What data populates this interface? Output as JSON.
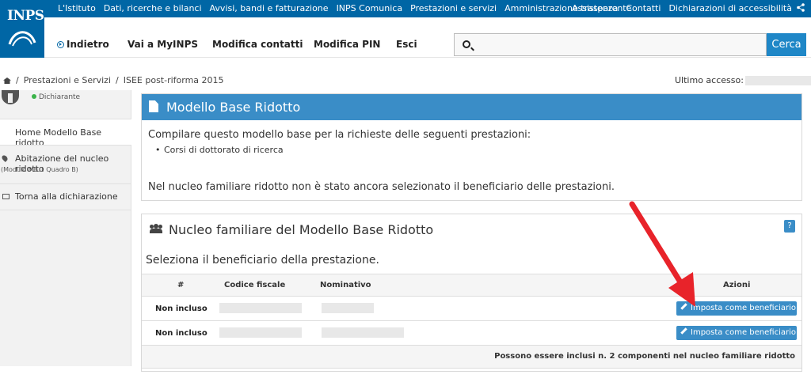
{
  "header": {
    "logo_text": "INPS",
    "top_links": [
      "L'Istituto",
      "Dati, ricerche e bilanci",
      "Avvisi, bandi e fatturazione",
      "INPS Comunica",
      "Prestazioni e servizi",
      "Amministrazione trasparente"
    ],
    "right_links": [
      "Assistenza",
      "Contatti",
      "Dichiarazioni di accessibilità"
    ],
    "share_icon": "share-icon"
  },
  "nav": {
    "back": "Indietro",
    "myinps": "Vai a MyINPS",
    "contacts": "Modifica contatti",
    "pin": "Modifica PIN",
    "exit": "Esci"
  },
  "search": {
    "placeholder": "",
    "value": "",
    "button": "Cerca"
  },
  "breadcrumb": {
    "items": [
      "Prestazioni e Servizi",
      "ISEE post-riforma 2015"
    ],
    "last_access_label": "Ultimo accesso:"
  },
  "sidebar": {
    "role": "Dichiarante",
    "items": [
      {
        "label": "Home Modello Base ridotto",
        "sub": ""
      },
      {
        "label": "Abitazione del nucleo ridotto",
        "sub": "(Modulo MB.1 Quadro B)"
      },
      {
        "label": "Torna alla dichiarazione",
        "sub": ""
      }
    ]
  },
  "panel1": {
    "title": "Modello Base Ridotto",
    "intro": "Compilare questo modello base per la richieste delle seguenti prestazioni:",
    "bullet": "Corsi di dottorato di ricerca",
    "note": "Nel nucleo familiare ridotto non è stato ancora selezionato il beneficiario delle prestazioni."
  },
  "panel2": {
    "title": "Nucleo familiare del Modello Base Ridotto",
    "help": "?",
    "subtitle": "Seleziona il beneficiario della prestazione.",
    "columns": [
      "#",
      "Codice fiscale",
      "Nominativo",
      "Azioni"
    ],
    "rows": [
      {
        "status": "Non incluso",
        "action": "Imposta come beneficiario"
      },
      {
        "status": "Non incluso",
        "action": "Imposta come beneficiario"
      }
    ],
    "footnote": "Possono essere inclusi n. 2 componenti nel nucleo familiare ridotto"
  },
  "colors": {
    "brand": "#0066a5",
    "panel_header": "#3a8dc7",
    "arrow": "#e8232a",
    "status_dot": "#3bb34a"
  }
}
